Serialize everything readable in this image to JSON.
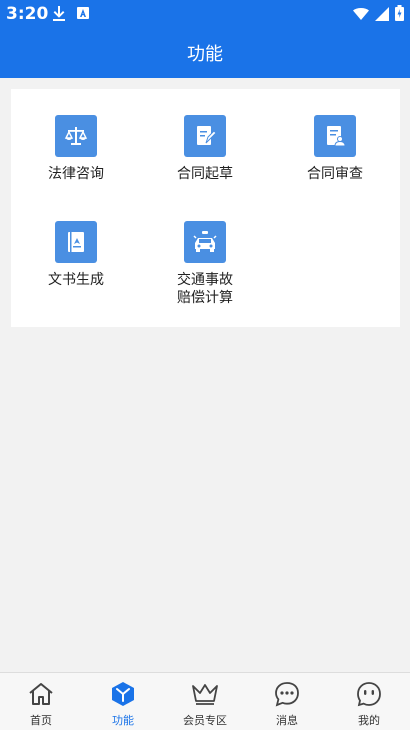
{
  "status_bar": {
    "time": "3:20"
  },
  "app_bar": {
    "title": "功能"
  },
  "functions": [
    {
      "label": "法律咨询",
      "icon": "scales-icon"
    },
    {
      "label": "合同起草",
      "icon": "contract-draft-icon"
    },
    {
      "label": "合同审查",
      "icon": "contract-review-icon"
    },
    {
      "label": "文书生成",
      "icon": "document-icon"
    },
    {
      "label": "交通事故\n赔偿计算",
      "icon": "car-accident-icon"
    }
  ],
  "bottom_nav": [
    {
      "label": "首页",
      "icon": "home-icon"
    },
    {
      "label": "功能",
      "icon": "function-cube-icon",
      "active": true
    },
    {
      "label": "会员专区",
      "icon": "crown-icon"
    },
    {
      "label": "消息",
      "icon": "message-icon"
    },
    {
      "label": "我的",
      "icon": "profile-face-icon"
    }
  ],
  "colors": {
    "primary": "#1a73e8",
    "icon_bg": "#4a8fe2",
    "background": "#f2f2f2"
  }
}
